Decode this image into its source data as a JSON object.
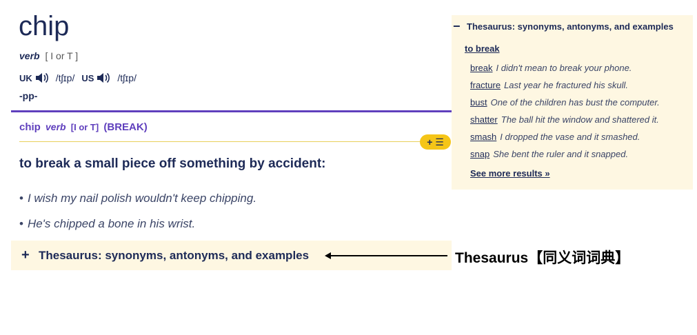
{
  "entry": {
    "headword": "chip",
    "pos": "verb",
    "grammar": "[ I or T ]",
    "pronunciations": [
      {
        "region": "UK",
        "ipa": "/tʃɪp/"
      },
      {
        "region": "US",
        "ipa": "/tʃɪp/"
      }
    ],
    "inflection": "-pp-"
  },
  "sense": {
    "word": "chip",
    "pos": "verb",
    "grammar": "[I or T]",
    "guideword": "(BREAK)",
    "list_button": "+ ☰",
    "definition": "to break a small piece off something by accident:",
    "examples": [
      "I wish my nail polish wouldn't keep chipping.",
      "He's chipped a bone in his wrist."
    ]
  },
  "thesaurus_bar": {
    "icon": "+",
    "label": "Thesaurus: synonyms, antonyms, and examples"
  },
  "annotation": "Thesaurus【同义词词典】",
  "thesaurus_panel": {
    "icon": "−",
    "title": "Thesaurus: synonyms, antonyms, and examples",
    "sense": "to break",
    "synonyms": [
      {
        "word": "break",
        "example": "I didn't mean to break your phone."
      },
      {
        "word": "fracture",
        "example": "Last year he fractured his skull."
      },
      {
        "word": "bust",
        "example": "One of the children has bust the computer."
      },
      {
        "word": "shatter",
        "example": "The ball hit the window and shattered it."
      },
      {
        "word": "smash",
        "example": "I dropped the vase and it smashed."
      },
      {
        "word": "snap",
        "example": "She bent the ruler and it snapped."
      }
    ],
    "more": "See more results »"
  },
  "colors": {
    "accent_purple": "#5f3fbd",
    "panel_bg": "#fef7e2",
    "button_yellow": "#f5c518",
    "text_navy": "#1d2a57"
  }
}
